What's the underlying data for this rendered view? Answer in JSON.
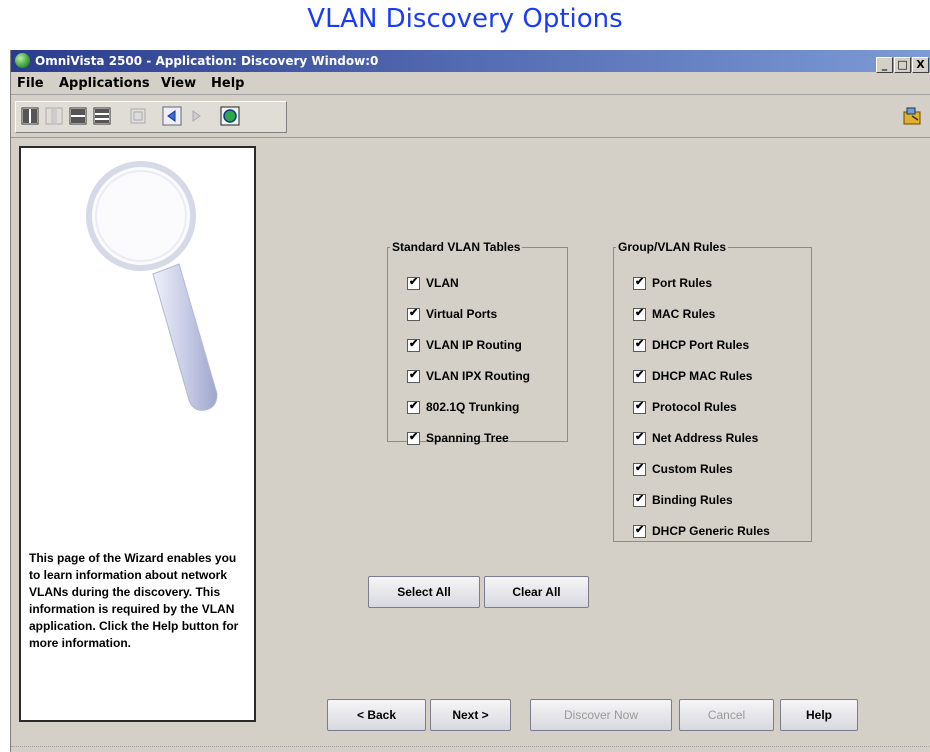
{
  "page": {
    "heading": "VLAN Discovery Options"
  },
  "window": {
    "title": "OmniVista 2500 -  Application: Discovery  Window:0",
    "controls": [
      "_",
      "□",
      "X"
    ]
  },
  "menu": {
    "items": [
      "File",
      "Applications",
      "View",
      "Help"
    ]
  },
  "toolbar": {
    "buttons": [
      "split-vertical-icon",
      "split-vertical-disabled-icon",
      "split-horizontal-icon",
      "split-horizontal-alt-icon",
      "panel-disabled-icon",
      "back-icon",
      "forward-disabled-icon",
      "discover-icon",
      "exit-icon"
    ]
  },
  "side_panel": {
    "image": "magnifying-glass-illustration",
    "text": "This page of the Wizard enables you to learn information about network VLANs during the discovery. This information is required by the VLAN application. Click the Help button for more information."
  },
  "standard_tables": {
    "title": "Standard VLAN Tables",
    "items": [
      {
        "label": "VLAN",
        "checked": true
      },
      {
        "label": "Virtual Ports",
        "checked": true
      },
      {
        "label": "VLAN IP Routing",
        "checked": true
      },
      {
        "label": "VLAN IPX Routing",
        "checked": true
      },
      {
        "label": "802.1Q Trunking",
        "checked": true
      },
      {
        "label": "Spanning Tree",
        "checked": true
      }
    ]
  },
  "group_rules": {
    "title": "Group/VLAN Rules",
    "items": [
      {
        "label": "Port Rules",
        "checked": true
      },
      {
        "label": "MAC Rules",
        "checked": true
      },
      {
        "label": "DHCP Port Rules",
        "checked": true
      },
      {
        "label": "DHCP MAC Rules",
        "checked": true
      },
      {
        "label": "Protocol Rules",
        "checked": true
      },
      {
        "label": "Net Address Rules",
        "checked": true
      },
      {
        "label": "Custom Rules",
        "checked": true
      },
      {
        "label": "Binding Rules",
        "checked": true
      },
      {
        "label": "DHCP Generic Rules",
        "checked": true
      }
    ]
  },
  "selection_buttons": {
    "select_all": "Select All",
    "clear_all": "Clear All"
  },
  "nav_buttons": {
    "back": "< Back",
    "next": "Next >",
    "discover_now": "Discover Now",
    "cancel": "Cancel",
    "help": "Help"
  },
  "colors": {
    "heading": "#1a3cf5",
    "titlebar_start": "#2a3c8e",
    "titlebar_end": "#7d9bd6",
    "window_bg": "#d4d0c8"
  }
}
